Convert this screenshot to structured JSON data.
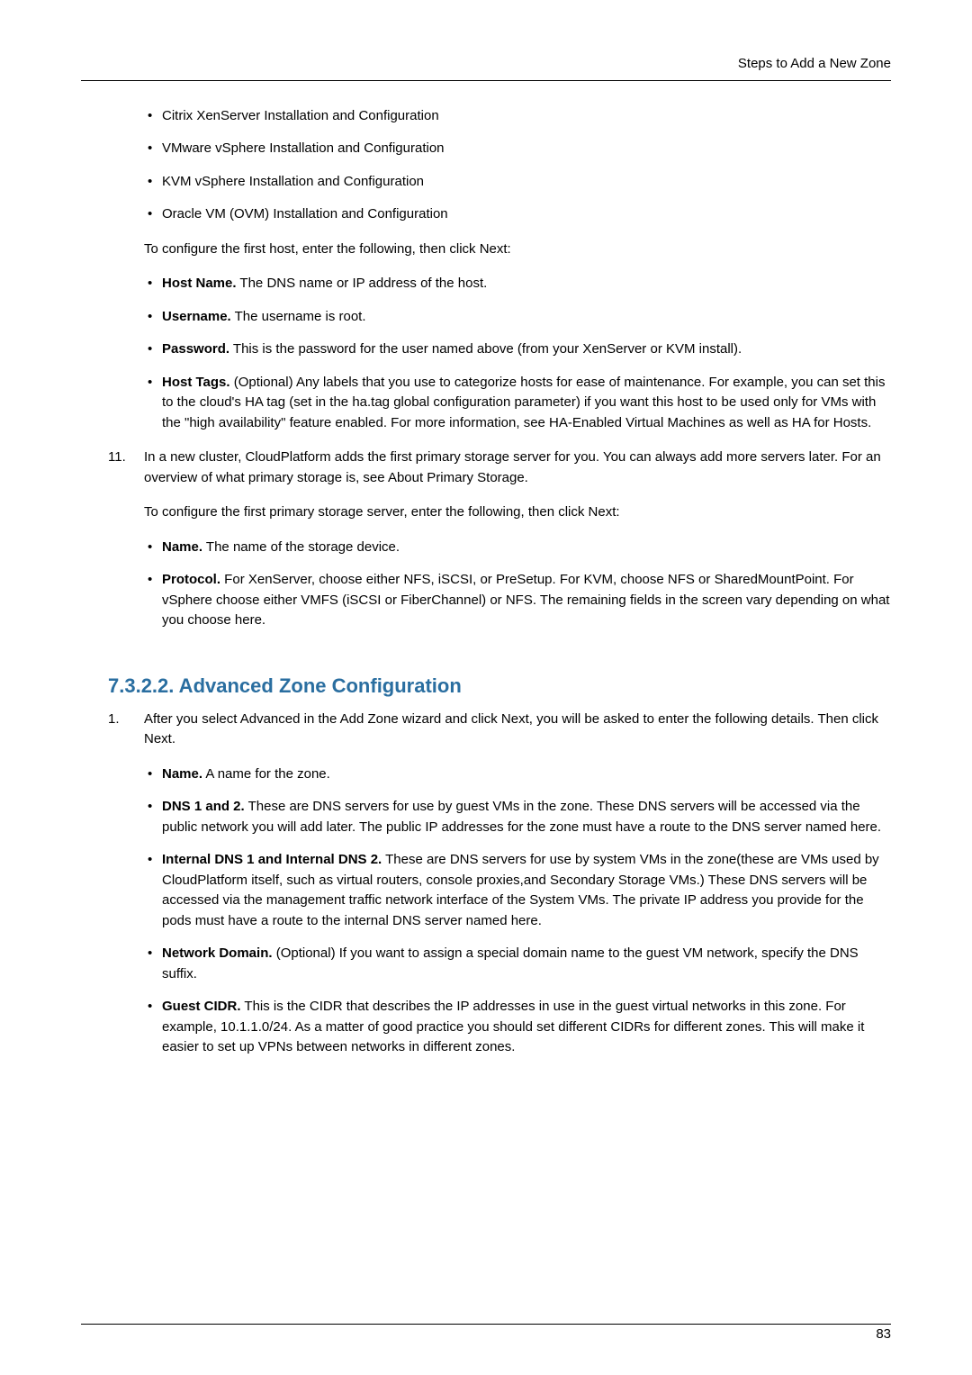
{
  "header": {
    "title": "Steps to Add a New Zone"
  },
  "topSection": {
    "installList": [
      "Citrix XenServer Installation and Configuration",
      "VMware vSphere Installation and Configuration",
      "KVM vSphere Installation and Configuration",
      "Oracle VM (OVM) Installation and Configuration"
    ],
    "configFirstHost": "To configure the first host, enter the following, then click Next:",
    "hostFields": [
      {
        "label": "Host Name.",
        "text": " The DNS name or IP address of the host."
      },
      {
        "label": "Username.",
        "text": " The username is root."
      },
      {
        "label": "Password.",
        "text": " This is the password for the user named above (from your XenServer or KVM install)."
      },
      {
        "label": "Host Tags.",
        "text": " (Optional) Any labels that you use to categorize hosts for ease of maintenance. For example, you can set this to the cloud's HA tag (set in the ha.tag global configuration parameter) if you want this host to be used only for VMs with the \"high availability\" feature enabled. For more information, see HA-Enabled Virtual Machines as well as HA for Hosts."
      }
    ]
  },
  "step11": {
    "num": "11.",
    "intro": "In a new cluster, CloudPlatform adds the first primary storage server for you. You can always add more servers later. For an overview of what primary storage is, see About Primary Storage.",
    "configLine": "To configure the first primary storage server, enter the following, then click Next:",
    "fields": [
      {
        "label": "Name.",
        "text": " The name of the storage device."
      },
      {
        "label": "Protocol.",
        "text": " For XenServer, choose either NFS, iSCSI, or PreSetup. For KVM, choose NFS or SharedMountPoint. For vSphere choose either VMFS (iSCSI or FiberChannel) or NFS. The remaining fields in the screen vary depending on what you choose here."
      }
    ]
  },
  "sectionHeading": "7.3.2.2. Advanced Zone Configuration",
  "adv": {
    "num": "1.",
    "intro": "After you select Advanced in the Add Zone wizard and click Next, you will be asked to enter the following details. Then click Next.",
    "fields": [
      {
        "label": "Name.",
        "text": " A name for the zone."
      },
      {
        "label": "DNS 1 and 2.",
        "text": " These are DNS servers for use by guest VMs in the zone. These DNS servers will be accessed via the public network you will add later. The public IP addresses for the zone must have a route to the DNS server named here."
      },
      {
        "label": "Internal DNS 1 and Internal DNS 2.",
        "text": " These are DNS servers for use by system VMs in the zone(these are VMs used by CloudPlatform itself, such as virtual routers, console proxies,and Secondary Storage VMs.) These DNS servers will be accessed via the management traffic network interface of the System VMs. The private IP address you provide for the pods must have a route to the internal DNS server named here."
      },
      {
        "label": "Network Domain.",
        "text": " (Optional) If you want to assign a special domain name to the guest VM network, specify the DNS suffix."
      },
      {
        "label": "Guest CIDR.",
        "text": " This is the CIDR that describes the IP addresses in use in the guest virtual networks in this zone. For example, 10.1.1.0/24. As a matter of good practice you should set different CIDRs for different zones. This will make it easier to set up VPNs between networks in different zones."
      }
    ]
  },
  "pageNumber": "83"
}
